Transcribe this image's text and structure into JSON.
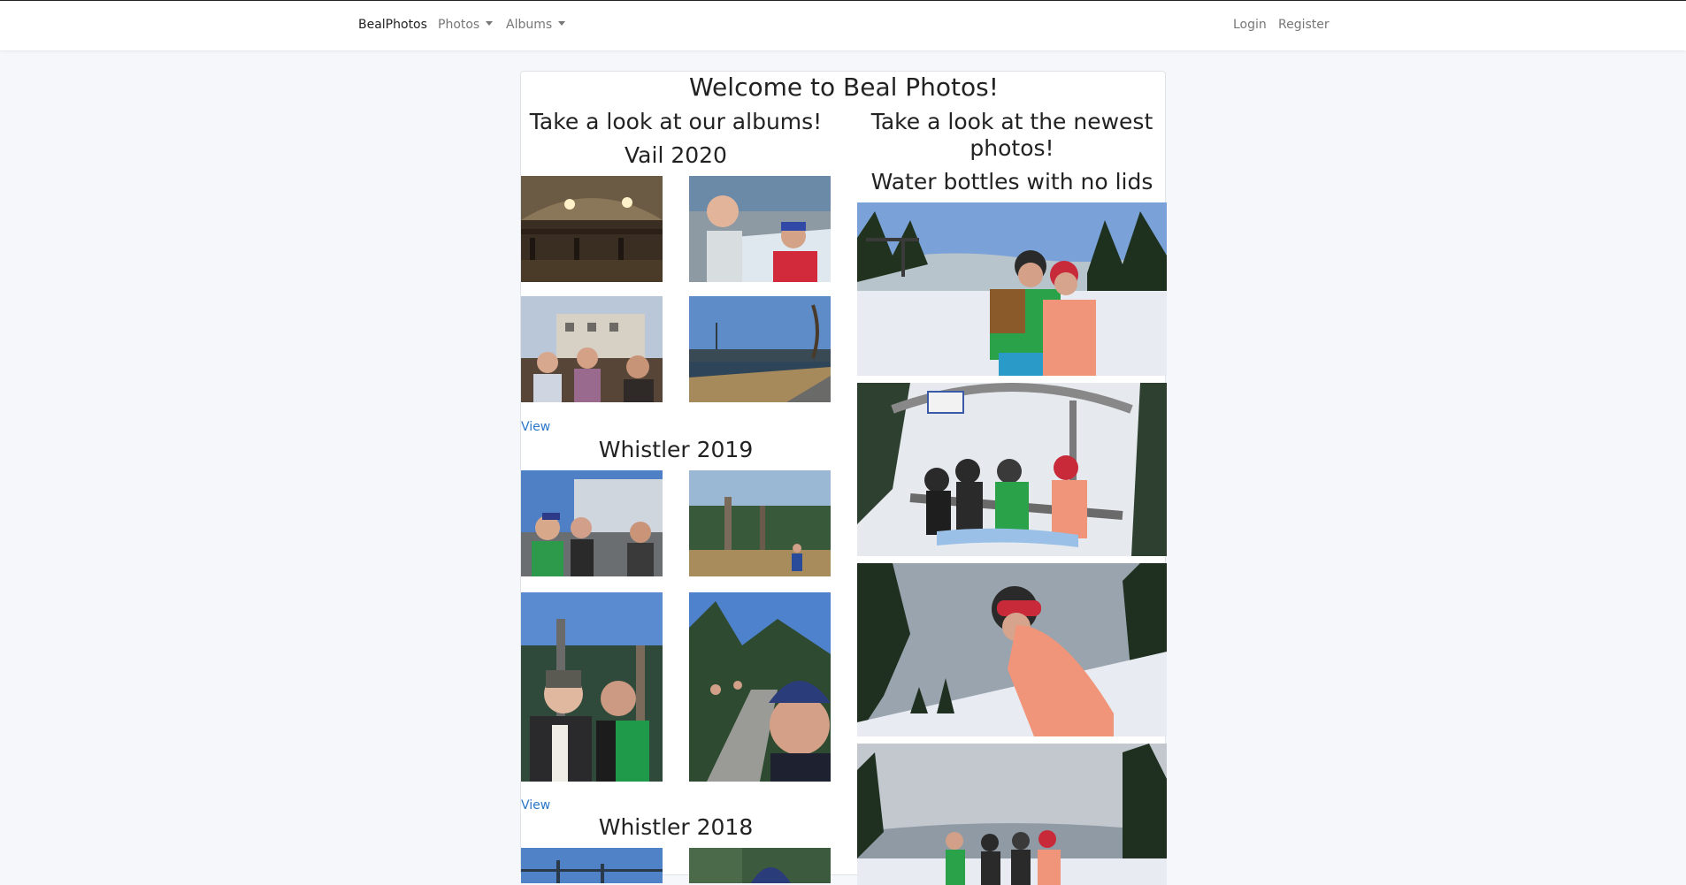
{
  "navbar": {
    "brand": "BealPhotos",
    "photos_menu": "Photos",
    "albums_menu": "Albums",
    "login": "Login",
    "register": "Register"
  },
  "main": {
    "title": "Welcome to Beal Photos!",
    "albums_heading": "Take a look at our albums!",
    "newest_heading": "Take a look at the newest photos!",
    "albums": [
      {
        "title": "Vail 2020",
        "view_label": "View"
      },
      {
        "title": "Whistler 2019",
        "view_label": "View"
      },
      {
        "title": "Whistler 2018"
      }
    ],
    "newest": {
      "photo_title": "Water bottles with no lids"
    }
  },
  "colors": {
    "link": "#2a76c8",
    "background": "#f6f7fb",
    "card": "#ffffff"
  }
}
